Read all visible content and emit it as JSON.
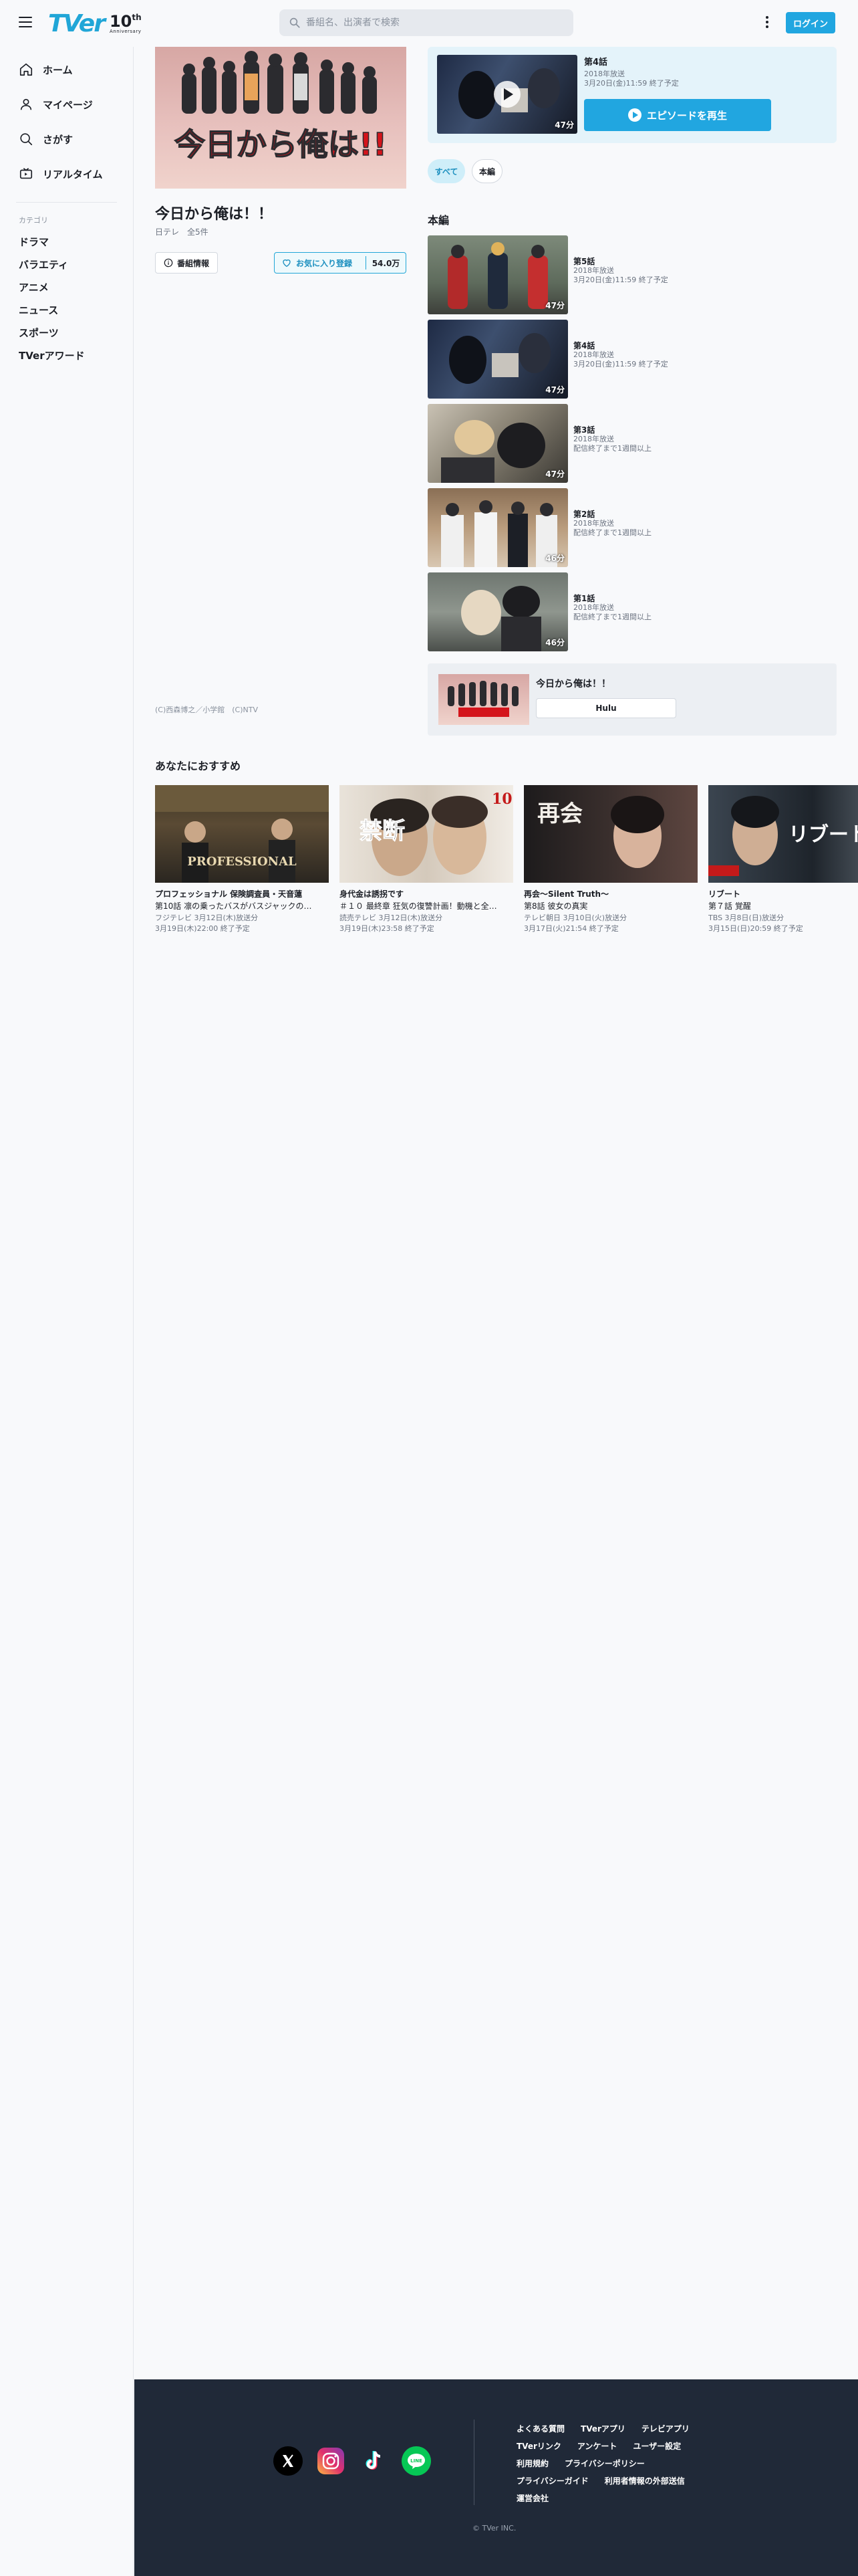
{
  "header": {
    "logo_text": "TVer",
    "logo_badge_big": "10",
    "logo_badge_sup": "th",
    "logo_badge_small": "Anniversary",
    "search_placeholder": "番組名、出演者で検索",
    "login_label": "ログイン"
  },
  "sidebar": {
    "nav": [
      {
        "label": "ホーム",
        "icon": "home-icon"
      },
      {
        "label": "マイページ",
        "icon": "person-icon"
      },
      {
        "label": "さがす",
        "icon": "search-icon"
      },
      {
        "label": "リアルタイム",
        "icon": "tv-icon"
      }
    ],
    "category_heading": "カテゴリ",
    "categories": [
      "ドラマ",
      "バラエティ",
      "アニメ",
      "ニュース",
      "スポーツ",
      "TVerアワード"
    ]
  },
  "program": {
    "hero_text": "今日から俺は!!",
    "title": "今日から俺は！！",
    "meta": "日テレ　全5件",
    "info_label": "番組情報",
    "fav_label": "お気に入り登録",
    "fav_count": "54.0万",
    "copyright": "(C)西森博之／小学館　(C)NTV"
  },
  "now_playing": {
    "title": "第4話",
    "year": "2018年放送",
    "availability": "3月20日(金)11:59 終了予定",
    "duration": "47分",
    "play_label": "エピソードを再生"
  },
  "tabs": [
    "すべて",
    "本編"
  ],
  "section_title": "本編",
  "episodes": [
    {
      "title": "第5話",
      "year": "2018年放送",
      "availability": "3月20日(金)11:59 終了予定",
      "duration": "47分"
    },
    {
      "title": "第4話",
      "year": "2018年放送",
      "availability": "3月20日(金)11:59 終了予定",
      "duration": "47分"
    },
    {
      "title": "第3話",
      "year": "2018年放送",
      "availability": "配信終了まで1週間以上",
      "duration": "47分"
    },
    {
      "title": "第2話",
      "year": "2018年放送",
      "availability": "配信終了まで1週間以上",
      "duration": "46分"
    },
    {
      "title": "第1話",
      "year": "2018年放送",
      "availability": "配信終了まで1週間以上",
      "duration": "46分"
    }
  ],
  "series_card": {
    "title": "今日から俺は！！",
    "button_label": "Hulu"
  },
  "recommendations": {
    "heading": "あなたにおすすめ",
    "items": [
      {
        "title": "プロフェッショナル 保険調査員・天音蓮",
        "subtitle": "第10話 凛の乗ったバスがバスジャックの…",
        "channel": "フジテレビ 3月12日(木)放送分",
        "availability": "3月19日(木)22:00 終了予定",
        "thumb_text": "PROFESSIONAL"
      },
      {
        "title": "身代金は誘拐です",
        "subtitle": "＃１０ 最終章 狂気の復讐計画！動機と全…",
        "channel": "読売テレビ 3月12日(木)放送分",
        "availability": "3月19日(木)23:58 終了予定",
        "thumb_text": "禁断"
      },
      {
        "title": "再会～Silent Truth～",
        "subtitle": "第8話 彼女の真実",
        "channel": "テレビ朝日 3月10日(火)放送分",
        "availability": "3月17日(火)21:54 終了予定",
        "thumb_text": "再会"
      },
      {
        "title": "リブート",
        "subtitle": "第７話 覚醒",
        "channel": "TBS 3月8日(日)放送分",
        "availability": "3月15日(日)20:59 終了予定",
        "thumb_text": "リブート"
      }
    ]
  },
  "footer": {
    "social": [
      {
        "name": "x-icon",
        "color": "#000000"
      },
      {
        "name": "instagram-icon",
        "color": "#d6249f"
      },
      {
        "name": "tiktok-icon",
        "color": "#000000"
      },
      {
        "name": "line-icon",
        "color": "#06c755"
      }
    ],
    "links_row1": [
      "よくある質問",
      "TVerアプリ",
      "テレビアプリ"
    ],
    "links_row2": [
      "TVerリンク",
      "アンケート",
      "ユーザー設定"
    ],
    "links_row3": [
      "利用規約",
      "プライバシーポリシー"
    ],
    "links_row4": [
      "プライバシーガイド",
      "利用者情報の外部送信"
    ],
    "links_row5": [
      "運営会社"
    ],
    "copyright": "© TVer INC."
  },
  "colors": {
    "accent": "#21a6e0",
    "footer_bg": "#202938",
    "now_card_bg": "#e4f3fa"
  }
}
